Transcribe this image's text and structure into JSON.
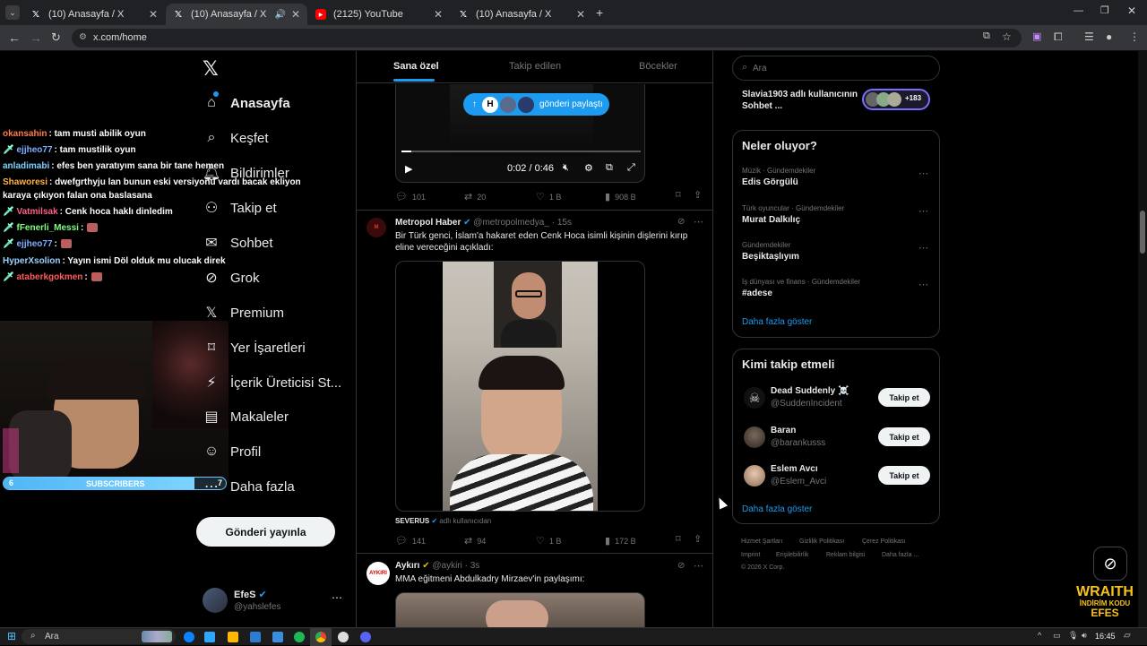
{
  "browser": {
    "tabs": [
      {
        "title": "(10) Anasayfa / X",
        "icon": "x-logo-icon"
      },
      {
        "title": "(10) Anasayfa / X",
        "icon": "x-logo-icon"
      },
      {
        "title": "(2125) YouTube",
        "icon": "youtube-icon"
      },
      {
        "title": "(10) Anasayfa / X",
        "icon": "x-logo-icon"
      }
    ],
    "url": "x.com/home"
  },
  "chat": [
    {
      "user": "okansahin",
      "msg": ": tam musti abilik oyun",
      "color": "#ff7b45"
    },
    {
      "user": "ejjheo77",
      "msg": ": tam mustilik oyun",
      "color": "#7fb0ff",
      "badge": true
    },
    {
      "user": "anladimabi",
      "msg": ": efes ben yaratıyım sana bir tane hemen",
      "color": "#7fd3ff"
    },
    {
      "user": "Shaworesi",
      "msg": ": dwefgrthyju lan bunun eski versiyonu vardı bacak ekliyon",
      "color": "#ffb347"
    },
    {
      "user": "",
      "msg": "karaya çıkıyon falan ona baslasana",
      "color": "#ffffff"
    },
    {
      "user": "Vatmilsak",
      "msg": ": Cenk hoca haklı dinledim",
      "color": "#ff5c8a",
      "badge": true
    },
    {
      "user": "fFenerli_Messi",
      "msg": ":",
      "color": "#7dff7d",
      "badge": true
    },
    {
      "user": "ejjheo77",
      "msg": ":",
      "color": "#7fb0ff",
      "badge": true
    },
    {
      "user": "HyperXsolion",
      "msg": ": Yayın ismi Döl olduk mu olucak direk",
      "color": "#9ad0ff"
    },
    {
      "user": "ataberkgokmen",
      "msg": ":",
      "color": "#ff5c5c",
      "badge": true
    }
  ],
  "overlay": {
    "subscribers_label": "SUBSCRIBERS",
    "sub_count": "6",
    "sub_goal": "7",
    "brand_line1": "WRAITH",
    "brand_line2": "İNDİRİM KODU",
    "brand_line3": "EFES"
  },
  "sidebar": {
    "items": [
      {
        "label": "Anasayfa",
        "icon": "home-icon"
      },
      {
        "label": "Keşfet",
        "icon": "search-icon"
      },
      {
        "label": "Bildirimler",
        "icon": "bell-icon"
      },
      {
        "label": "Takip et",
        "icon": "add-user-icon"
      },
      {
        "label": "Sohbet",
        "icon": "mail-icon"
      },
      {
        "label": "Grok",
        "icon": "grok-icon"
      },
      {
        "label": "Premium",
        "icon": "x-logo-icon"
      },
      {
        "label": "Yer İşaretleri",
        "icon": "bookmark-icon"
      },
      {
        "label": "İçerik Üreticisi St...",
        "icon": "studio-icon"
      },
      {
        "label": "Makaleler",
        "icon": "article-icon"
      },
      {
        "label": "Profil",
        "icon": "profile-icon"
      },
      {
        "label": "Daha fazla",
        "icon": "more-circle-icon"
      }
    ],
    "post_button": "Gönderi yayınla",
    "account": {
      "name": "EfeS",
      "handle": "@yahslefes"
    }
  },
  "feed": {
    "tabs": [
      "Sana özel",
      "Takip edilen",
      "Böcekler"
    ],
    "share_pill": "gönderi paylaştı",
    "video_time": "0:02 / 0:46",
    "post1_stats": {
      "replies": "101",
      "reposts": "20",
      "likes": "1 B",
      "views": "908 B"
    },
    "post2": {
      "name": "Metropol Haber",
      "handle": "@metropolmedya_ · 15s",
      "text": "Bir Türk genci, İslam'a hakaret eden Cenk Hoca isimli kişinin dişlerini kırıp eline vereceğini açıkladı:",
      "tag_user": "SEVERUS",
      "tag_suffix": "adlı kullanıcıdan",
      "stats": {
        "replies": "141",
        "reposts": "94",
        "likes": "1 B",
        "views": "172 B"
      }
    },
    "post3": {
      "name": "Aykırı",
      "handle": "@aykiri · 3s",
      "text": "MMA eğitmeni Abdulkadry Mirzaev'in paylaşımı:"
    }
  },
  "right": {
    "search_placeholder": "Ara",
    "space": {
      "title": "Slavia1903 adlı kullanıcının Sohbet ...",
      "count": "+183"
    },
    "trends_title": "Neler oluyor?",
    "trends": [
      {
        "sub": "Müzik · Gündemdekiler",
        "title": "Edis Görgülü"
      },
      {
        "sub": "Türk oyuncular · Gündemdekiler",
        "title": "Murat Dalkılıç"
      },
      {
        "sub": "Gündemdekiler",
        "title": "Beşiktaşlıyım"
      },
      {
        "sub": "İş dünyası ve finans · Gündemdekiler",
        "title": "#adese"
      }
    ],
    "show_more": "Daha fazla göster",
    "follow_title": "Kimi takip etmeli",
    "follow": [
      {
        "name": "Dead Suddenly ☠️",
        "handle": "@SuddenIncident"
      },
      {
        "name": "Baran",
        "handle": "@barankusss"
      },
      {
        "name": "Eslem Avcı",
        "handle": "@Eslem_Avci"
      }
    ],
    "follow_btn": "Takip et",
    "follow_more": "Daha fazla göster",
    "footer": [
      "Hizmet Şartları",
      "Gizlilik Politikası",
      "Çerez Politikası",
      "Imprint",
      "Erişilebilirlik",
      "Reklam bilgisi",
      "Daha fazla ...",
      "© 2026 X Corp."
    ]
  },
  "taskbar": {
    "search": "Ara",
    "time": "16:45"
  },
  "colors": {
    "accent": "#1d9bf0",
    "bg": "#000000",
    "border": "#2f3336"
  }
}
